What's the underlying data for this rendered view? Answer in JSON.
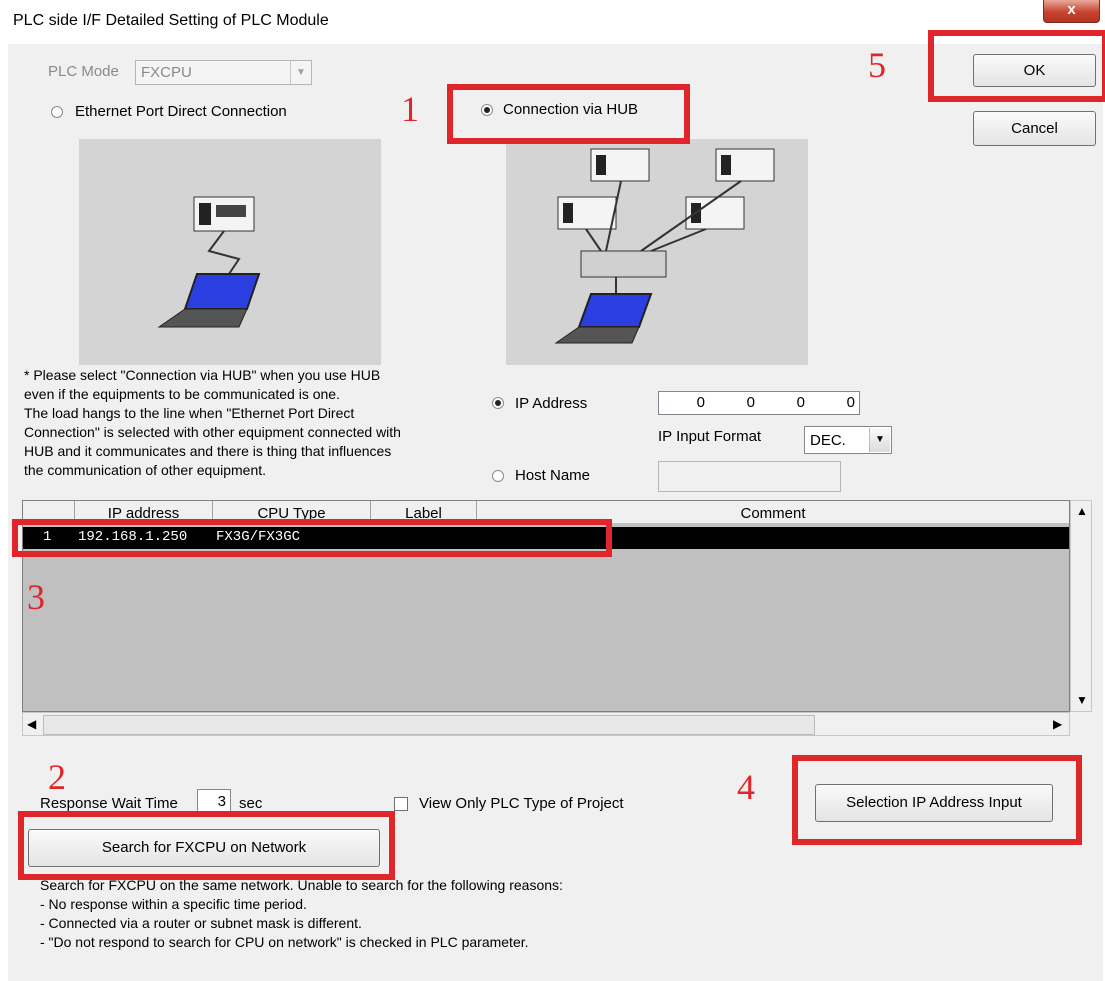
{
  "window": {
    "title": "PLC side I/F Detailed Setting of PLC Module",
    "close_label": "x"
  },
  "plc_mode": {
    "label": "PLC Mode",
    "value": "FXCPU"
  },
  "connection": {
    "direct_label": "Ethernet Port Direct Connection",
    "hub_label": "Connection via HUB",
    "selected": "hub"
  },
  "buttons": {
    "ok": "OK",
    "cancel": "Cancel",
    "search": "Search for FXCPU on Network",
    "selection_ip": "Selection IP Address Input"
  },
  "note_lines": [
    "* Please select \"Connection via HUB\" when you use HUB",
    "even if the equipments to be communicated is one.",
    "The load hangs to the line when \"Ethernet Port Direct",
    "Connection\" is selected with other equipment connected with",
    "HUB and it communicates and there is thing that influences",
    "the communication of other equipment."
  ],
  "ip": {
    "label": "IP Address",
    "octets": [
      "0",
      "0",
      "0",
      "0"
    ],
    "format_label": "IP Input Format",
    "format_value": "DEC.",
    "host_label": "Host Name",
    "host_value": ""
  },
  "table": {
    "columns": [
      "IP address",
      "CPU Type",
      "Label",
      "Comment"
    ],
    "rows": [
      {
        "no": "1",
        "ip": "192.168.1.250",
        "cpu": "FX3G/FX3GC",
        "label": "",
        "comment": ""
      }
    ]
  },
  "response": {
    "label": "Response Wait Time",
    "value": "3",
    "unit": "sec"
  },
  "view_only": {
    "label": "View Only PLC Type of Project",
    "checked": false
  },
  "search_info_lines": [
    "Search for FXCPU on the same network. Unable to search for the following reasons:",
    "- No response within a specific time period.",
    "- Connected via a router or subnet mask is different.",
    "- \"Do not respond to search for CPU on network\" is checked in PLC parameter."
  ],
  "annotations": [
    "1",
    "2",
    "3",
    "4",
    "5"
  ],
  "colors": {
    "highlight": "#e0262a",
    "selected_row": "#000000"
  }
}
